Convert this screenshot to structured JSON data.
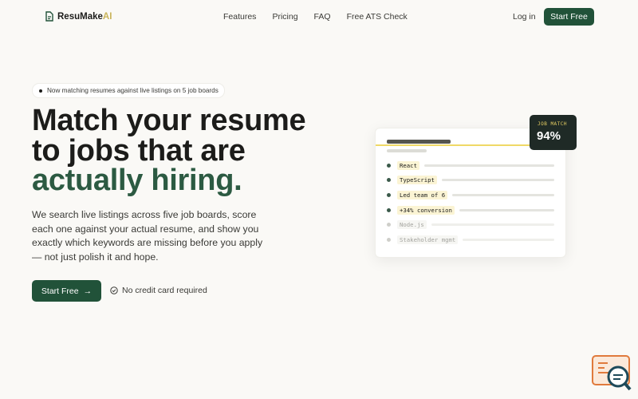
{
  "brand": {
    "part1": "Resu",
    "part2": "Make",
    "part3": "AI"
  },
  "nav": {
    "links": [
      "Features",
      "Pricing",
      "FAQ",
      "Free ATS Check"
    ],
    "login": "Log in",
    "cta": "Start Free"
  },
  "hero": {
    "badge": "Now matching resumes against live listings on 5 job boards",
    "title_line1": "Match your resume",
    "title_line2": "to jobs that are",
    "title_line3": "actually hiring.",
    "subtitle": "We search live listings across five job boards, score each one against your actual resume, and show you exactly which keywords are missing before you apply — not just polish it and hope.",
    "cta": "Start Free",
    "cta_arrow": "→",
    "note": "No credit card required"
  },
  "card": {
    "match_label": "JOB MATCH",
    "match_value": "94%",
    "keywords": [
      {
        "text": "React",
        "status": "matched"
      },
      {
        "text": "TypeScript",
        "status": "matched"
      },
      {
        "text": "Led team of 6",
        "status": "matched"
      },
      {
        "text": "+34% conversion",
        "status": "matched"
      },
      {
        "text": "Node.js",
        "status": "missing"
      },
      {
        "text": "Stakeholder mgmt",
        "status": "missing"
      }
    ]
  },
  "colors": {
    "accent": "#215239",
    "highlight": "#f0d966",
    "brand_ai": "#c9b45a"
  },
  "icons": {
    "logo": "document-icon",
    "note": "check-circle-icon",
    "chat": "chat-support-icon"
  }
}
